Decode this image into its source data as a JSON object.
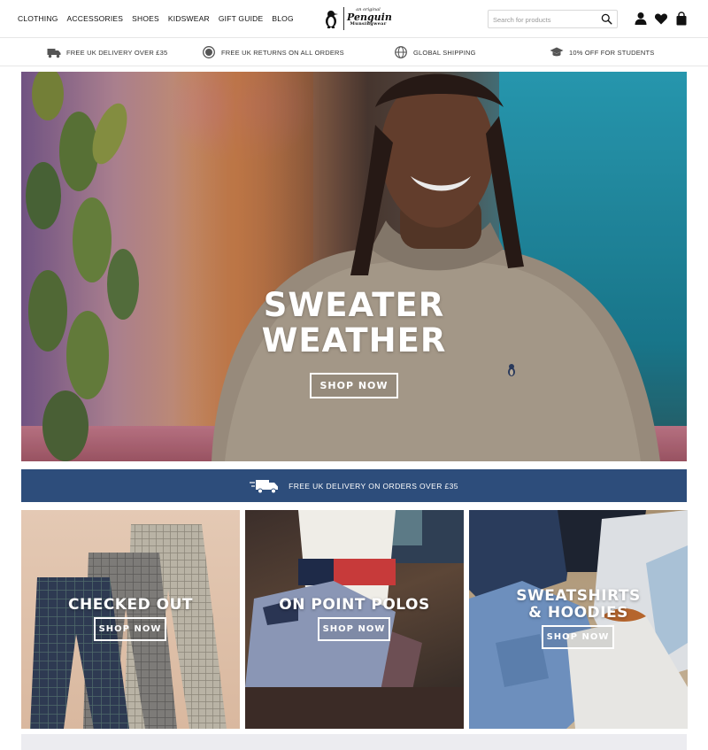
{
  "nav": {
    "items": [
      "CLOTHING",
      "ACCESSORIES",
      "SHOES",
      "KIDSWEAR",
      "GIFT GUIDE",
      "BLOG"
    ]
  },
  "logo": {
    "line1": "an original",
    "line2": "Penguin",
    "line3": "Munsingwear",
    "icon": "penguin-icon"
  },
  "search": {
    "placeholder": "Search for products",
    "value": "",
    "icon": "search-icon"
  },
  "header_icons": [
    "account-icon",
    "heart-icon",
    "bag-icon"
  ],
  "usp": [
    {
      "icon": "delivery-truck-icon",
      "label": "FREE UK DELIVERY OVER £35"
    },
    {
      "icon": "returns-icon",
      "label": "FREE UK RETURNS ON ALL ORDERS"
    },
    {
      "icon": "globe-icon",
      "label": "GLOBAL SHIPPING"
    },
    {
      "icon": "graduation-cap-icon",
      "label": "10% OFF FOR STUDENTS"
    }
  ],
  "hero": {
    "title_line1": "SWEATER",
    "title_line2": "WEATHER",
    "button_label": "SHOP NOW"
  },
  "delivery_bar": {
    "icon": "delivery-truck-icon",
    "label": "FREE UK DELIVERY ON ORDERS OVER £35",
    "color": "#2d4d7b"
  },
  "tiles": [
    {
      "title_line1": "CHECKED OUT",
      "title_line2": "",
      "button_label": "SHOP NOW"
    },
    {
      "title_line1": "ON POINT POLOS",
      "title_line2": "",
      "button_label": "SHOP NOW"
    },
    {
      "title_line1": "SWEATSHIRTS",
      "title_line2": "& HOODIES",
      "button_label": "SHOP NOW"
    }
  ],
  "colors": {
    "accent_navy": "#2d4d7b",
    "text_dark": "#111111"
  }
}
